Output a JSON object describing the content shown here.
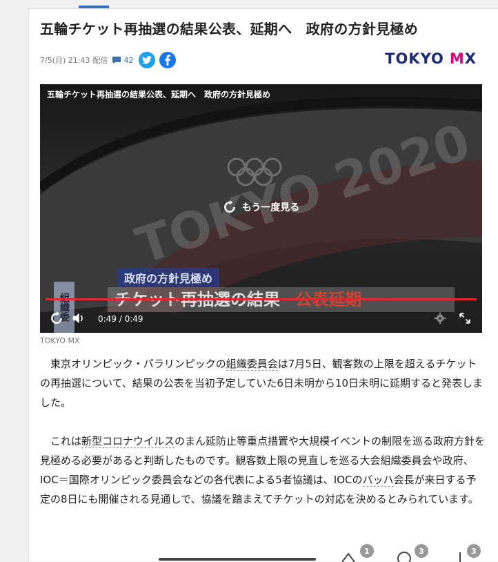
{
  "article": {
    "title": "五輪チケット再抽選の結果公表、延期へ　政府の方針見極め",
    "datetime": "7/5(月) 21:43",
    "delivered": "配信",
    "comment_count": "42",
    "source_logo": "TOKYO MX"
  },
  "video": {
    "title": "五輪チケット再抽選の結果公表、延期へ　政府の方針見極め",
    "replay_label": "もう一度見る",
    "time_display": "0:49 / 0:49",
    "progress": 1.0,
    "telop_upper": "政府の方針見極め",
    "telop_main_a": "チケット再抽選の結果",
    "telop_main_b": "公表延期",
    "side_tag": "組織委"
  },
  "credit": "TOKYO MX",
  "body": {
    "p1": [
      "東京オリンピック・パラリンピックの",
      "組織委員会",
      "は7月5日、観客数の上限を超えるチケットの再抽選について、結果の公表を当初予定していた6日未明から10日未明に延期すると発表しました。"
    ],
    "p2": [
      "これは",
      "新型コロナウイルス",
      "のまん延防止等重点措置や大規模イベントの制限を巡る政府方針を見極める必要があると判断したものです。観客数上限の見直しを巡る大会組織委員会や政府、IOC＝国際オリンピック委員会などの各代表による5者協議は、IOCの",
      "バッハ",
      "会長が来日する予定の8日にも開催される見通しで、協議を踏まえてチケットの対応を決めるとみられています。"
    ]
  },
  "footer_badges": [
    "1",
    "3",
    "3"
  ],
  "colors": {
    "accent": "#3d6fb4",
    "twitter": "#1da1f2",
    "facebook": "#1877f2",
    "logo_magenta": "#e4007f",
    "logo_navy": "#1b2a7a",
    "progress_red": "#d32f2f"
  }
}
